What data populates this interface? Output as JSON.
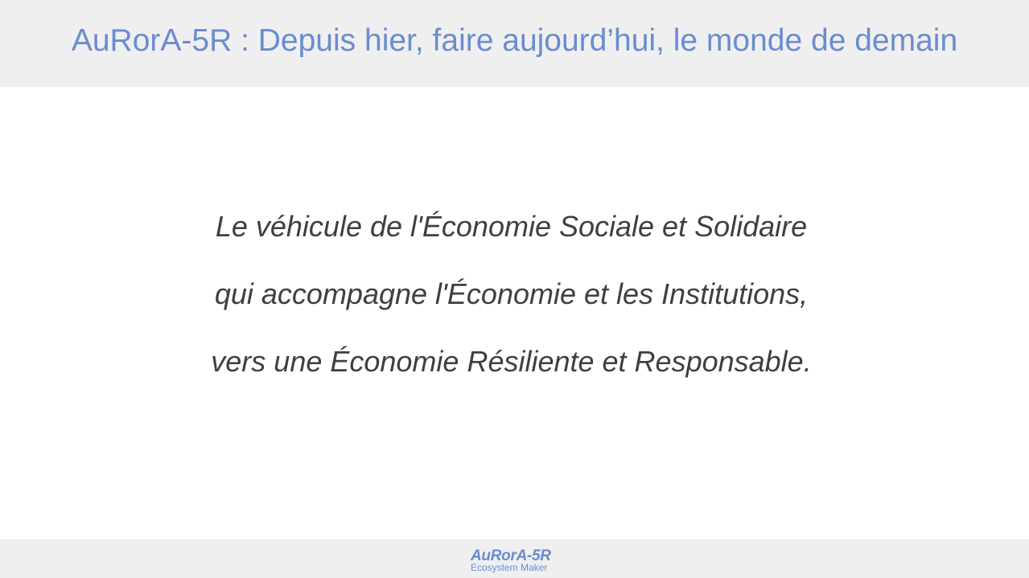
{
  "header": {
    "title": "AuRorA-5R : Depuis hier, faire aujourd’hui, le monde de demain"
  },
  "body": {
    "lines": [
      "Le véhicule de l'Économie Sociale et Solidaire",
      "qui accompagne l'Économie et les Institutions,",
      "vers une Économie Résiliente et Responsable."
    ]
  },
  "footer": {
    "logo_name": "AuRorA-5R",
    "logo_tagline": "Ecosystem Maker"
  },
  "colors": {
    "accent": "#6a8cd0",
    "band_background": "#efefef",
    "body_text": "#3f3f3f"
  }
}
